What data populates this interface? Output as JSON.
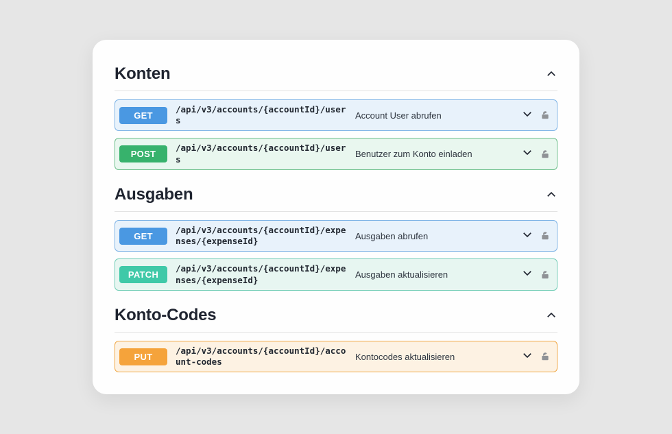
{
  "sections": [
    {
      "title": "Konten",
      "endpoints": [
        {
          "method": "GET",
          "methodClass": "get",
          "path": "/api/v3/accounts/{accountId}/users",
          "desc": "Account User abrufen"
        },
        {
          "method": "POST",
          "methodClass": "post",
          "path": "/api/v3/accounts/{accountId}/users",
          "desc": "Benutzer zum Konto einladen"
        }
      ]
    },
    {
      "title": "Ausgaben",
      "endpoints": [
        {
          "method": "GET",
          "methodClass": "get",
          "path": "/api/v3/accounts/{accountId}/expenses/{expenseId}",
          "desc": "Ausgaben abrufen"
        },
        {
          "method": "PATCH",
          "methodClass": "patch",
          "path": "/api/v3/accounts/{accountId}/expenses/{expenseId}",
          "desc": "Ausgaben aktualisieren"
        }
      ]
    },
    {
      "title": "Konto-Codes",
      "endpoints": [
        {
          "method": "PUT",
          "methodClass": "put",
          "path": "/api/v3/accounts/{accountId}/account-codes",
          "desc": "Kontocodes aktualisieren"
        }
      ]
    }
  ]
}
